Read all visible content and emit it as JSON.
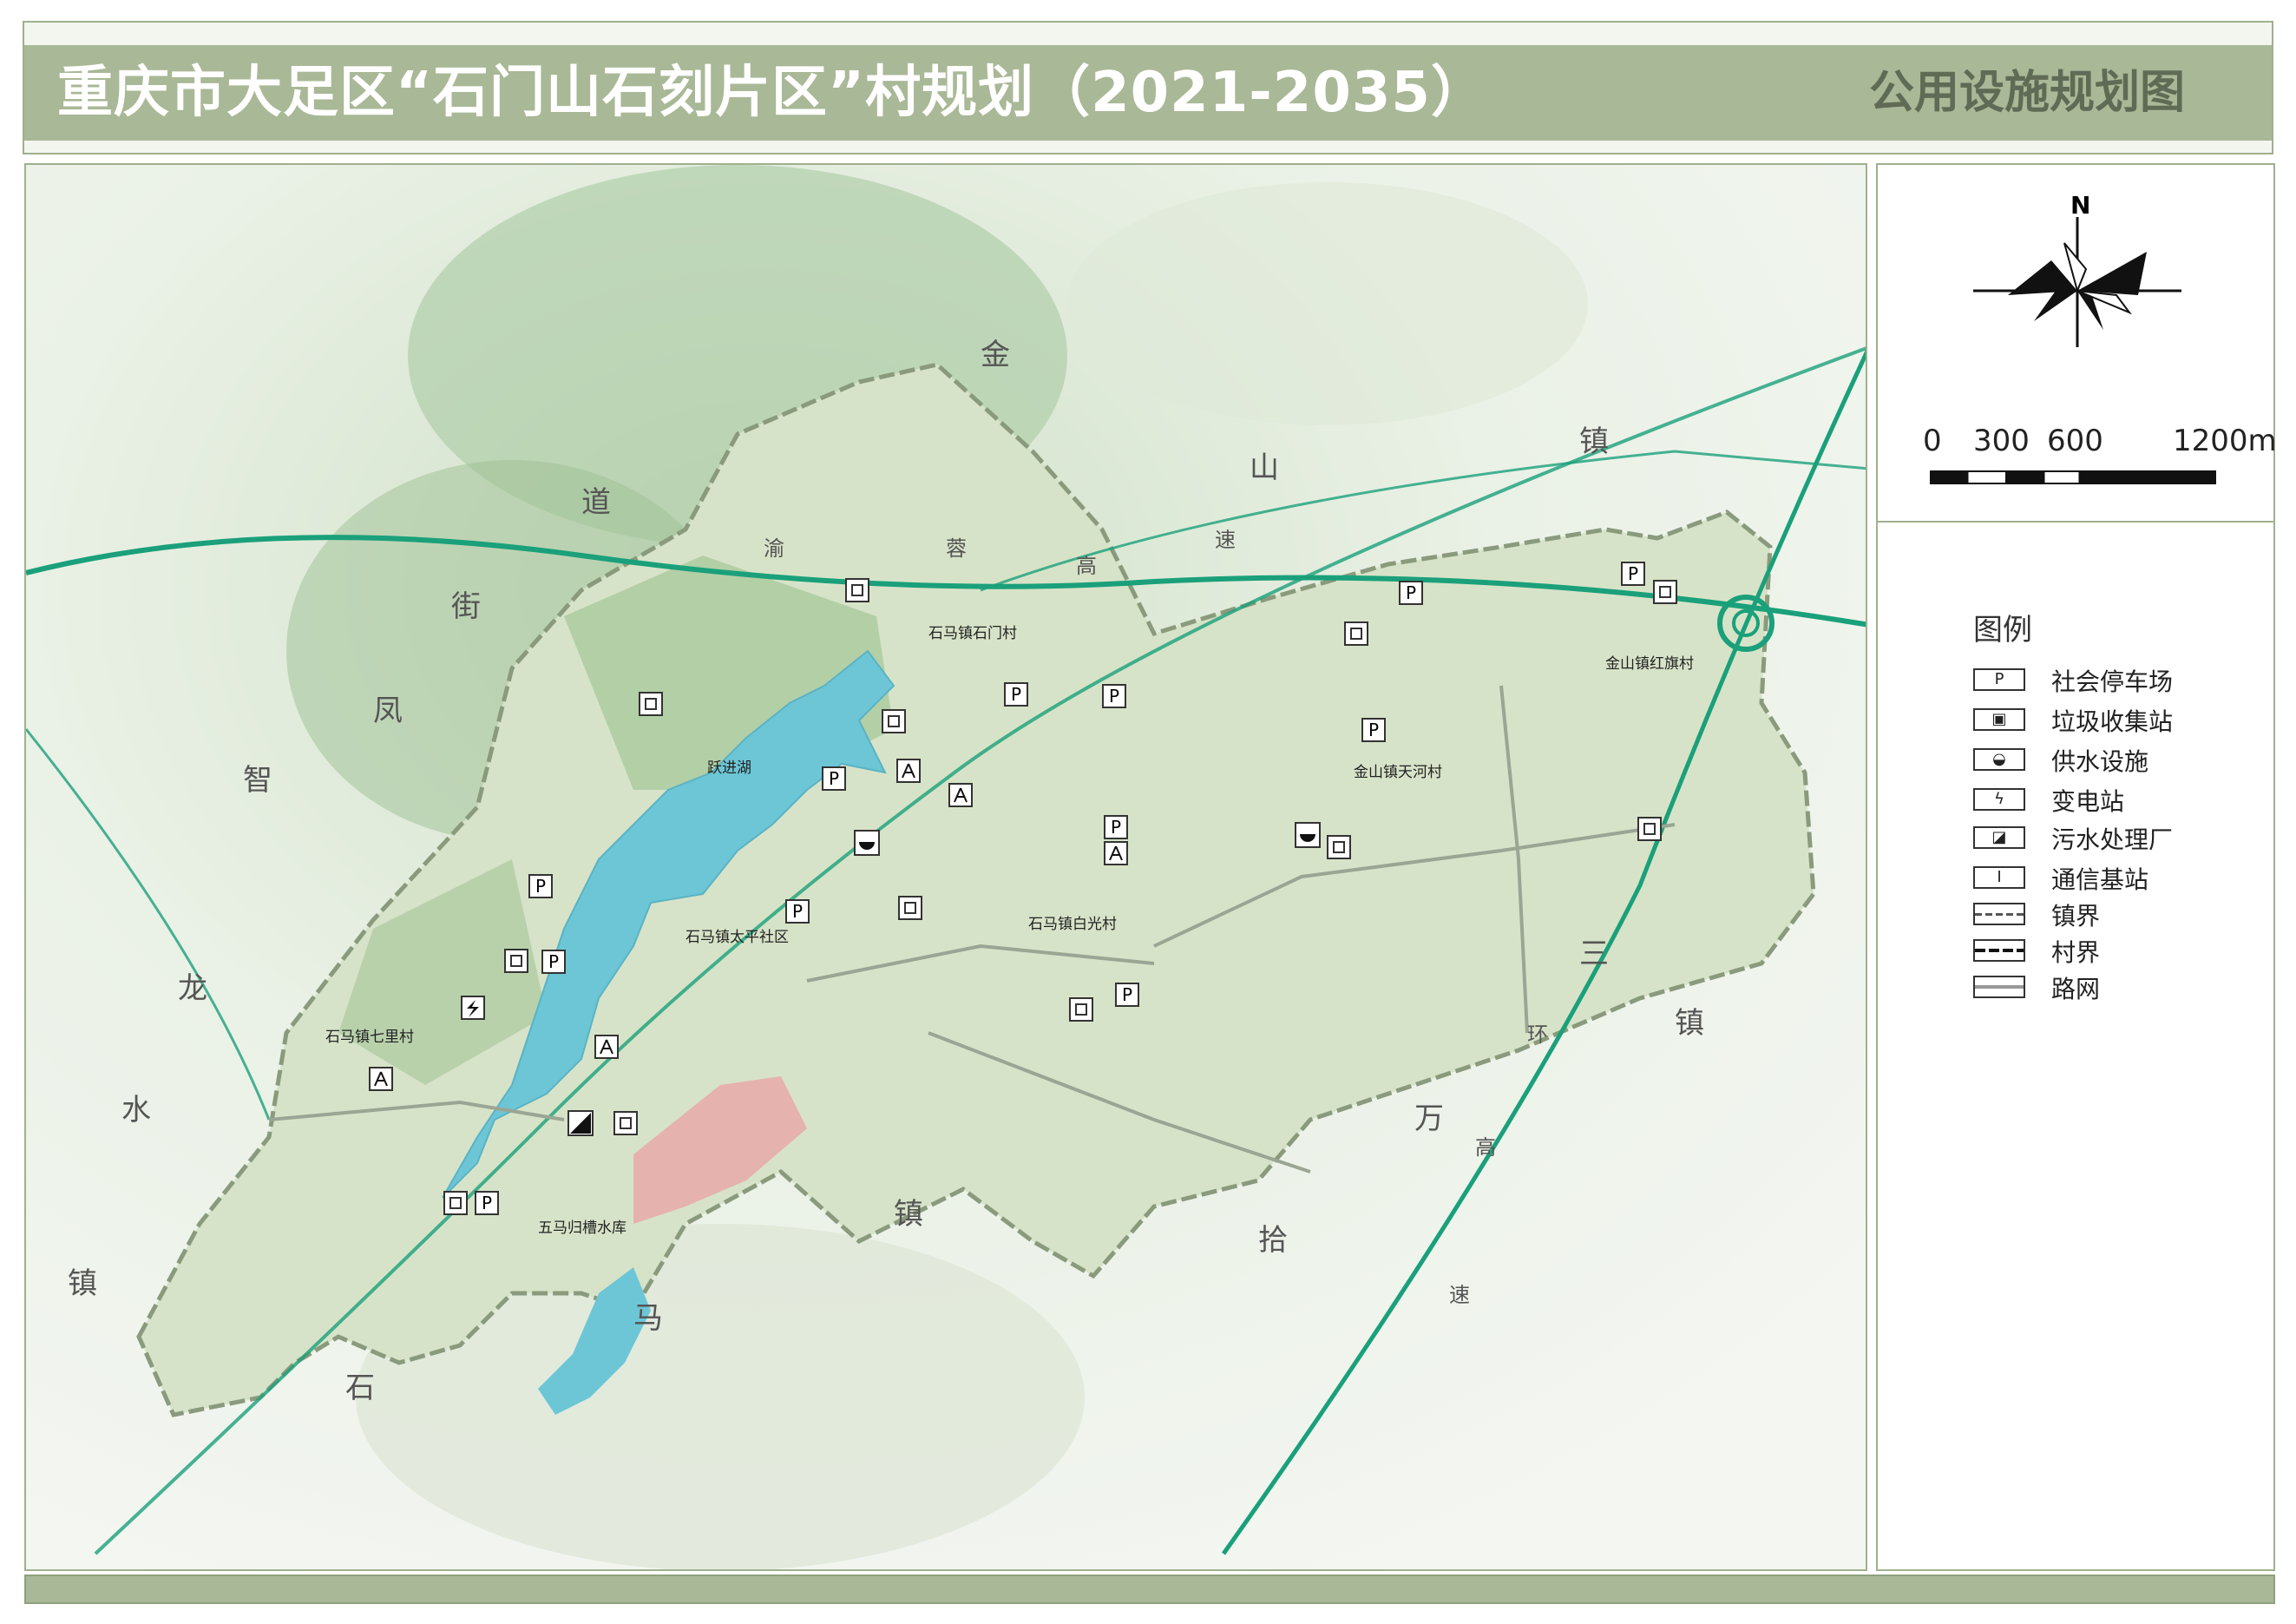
{
  "header": {
    "title": "重庆市大足区“石门山石刻片区”村规划（2021-2035）",
    "subtitle": "公用设施规划图"
  },
  "scalebar": {
    "labels": [
      "0",
      "300",
      "600",
      "1200m"
    ]
  },
  "north": {
    "label": "N"
  },
  "legend": {
    "title": "图例",
    "items": [
      {
        "symbol": "P",
        "label": "社会停车场"
      },
      {
        "symbol": "▣",
        "label": "垃圾收集站"
      },
      {
        "symbol": "◒",
        "label": "供水设施"
      },
      {
        "symbol": "ϟ",
        "label": "变电站"
      },
      {
        "symbol": "◪",
        "label": "污水处理厂"
      },
      {
        "symbol": "Ⅰ",
        "label": "通信基站"
      },
      {
        "symbol": "",
        "label": "镇界"
      },
      {
        "symbol": "",
        "label": "村界"
      },
      {
        "symbol": "",
        "label": "路网"
      }
    ]
  },
  "map": {
    "region_labels": [
      "金",
      "山",
      "镇",
      "道",
      "街",
      "凤",
      "智",
      "龙",
      "水",
      "镇",
      "石",
      "马",
      "镇",
      "拾",
      "万",
      "三",
      "镇",
      "环",
      "高",
      "速",
      "渝",
      "蓉",
      "高",
      "速"
    ],
    "village_labels": [
      "石马镇石门村",
      "跃进湖",
      "石马镇太平社区",
      "石马镇白光村",
      "金山镇天河村",
      "金山镇红旗村",
      "石马镇七里村",
      "五马归槽水库"
    ],
    "colors": {
      "water": "#6cc6d6",
      "road_green": "#1aa07a",
      "area_fill": "#d7e3c8",
      "forest": "#8fb889",
      "urban": "#e8a9a8"
    }
  }
}
